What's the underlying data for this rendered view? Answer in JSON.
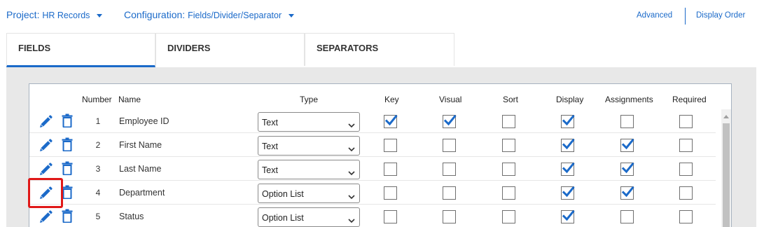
{
  "topbar": {
    "project_label": "Project:",
    "project_value": "HR Records",
    "config_label": "Configuration:",
    "config_value": "Fields/Divider/Separator",
    "advanced_link": "Advanced",
    "display_order_link": "Display Order"
  },
  "tabs": [
    {
      "label": "FIELDS",
      "active": true
    },
    {
      "label": "DIVIDERS",
      "active": false
    },
    {
      "label": "SEPARATORS",
      "active": false
    }
  ],
  "table": {
    "headers": {
      "number": "Number",
      "name": "Name",
      "type": "Type",
      "key": "Key",
      "visual": "Visual",
      "sort": "Sort",
      "display": "Display",
      "assignments": "Assignments",
      "required": "Required"
    },
    "rows": [
      {
        "number": "1",
        "name": "Employee ID",
        "type": "Text",
        "key": true,
        "visual": true,
        "sort": false,
        "display": true,
        "assignments": false,
        "required": false
      },
      {
        "number": "2",
        "name": "First Name",
        "type": "Text",
        "key": false,
        "visual": false,
        "sort": false,
        "display": true,
        "assignments": true,
        "required": false
      },
      {
        "number": "3",
        "name": "Last Name",
        "type": "Text",
        "key": false,
        "visual": false,
        "sort": false,
        "display": true,
        "assignments": true,
        "required": false
      },
      {
        "number": "4",
        "name": "Department",
        "type": "Option List",
        "key": false,
        "visual": false,
        "sort": false,
        "display": true,
        "assignments": true,
        "required": false
      },
      {
        "number": "5",
        "name": "Status",
        "type": "Option List",
        "key": false,
        "visual": false,
        "sort": false,
        "display": true,
        "assignments": false,
        "required": false
      }
    ]
  },
  "highlighted_row_index": 3,
  "colors": {
    "accent": "#1b6ac9",
    "highlight": "#e01818",
    "panel": "#e8e8e8"
  }
}
